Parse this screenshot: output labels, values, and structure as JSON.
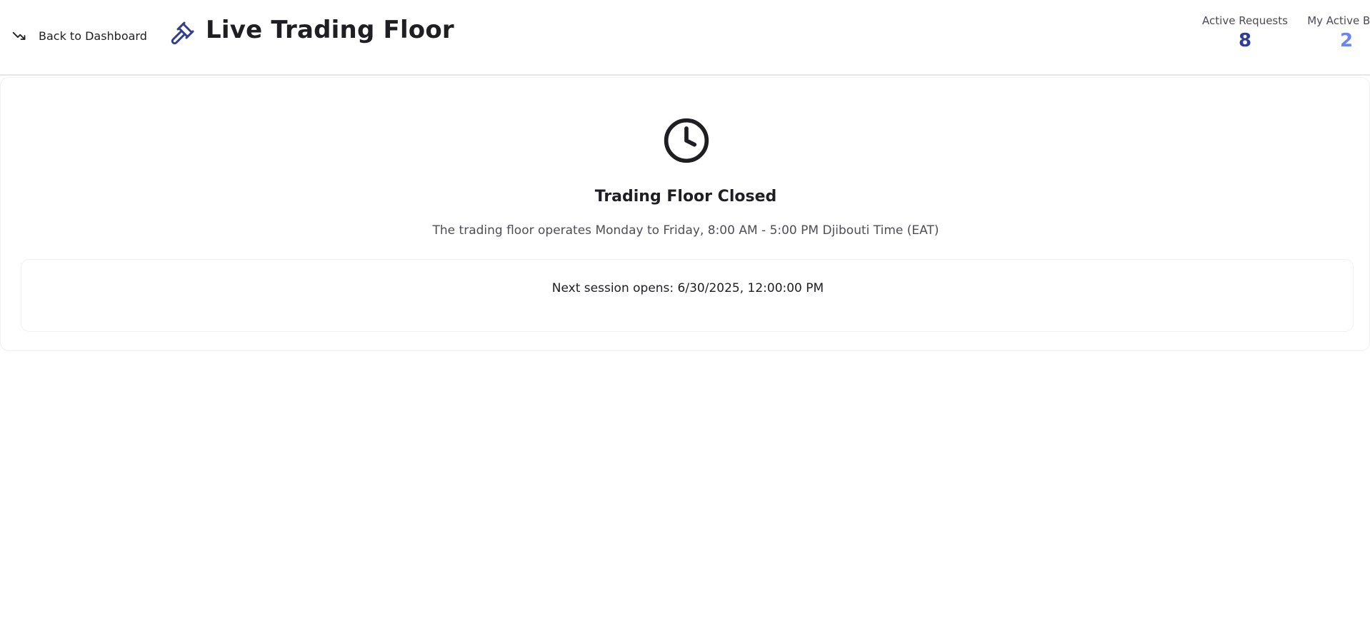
{
  "header": {
    "back_label": "Back to Dashboard",
    "back_icon": "trending-down-icon",
    "title": "Live Trading Floor",
    "title_icon": "gavel-icon",
    "stats": {
      "active_requests_label": "Active Requests",
      "active_requests_value": "8",
      "my_active_bids_label": "My Active Bids",
      "my_active_bids_value": "2"
    }
  },
  "status": {
    "icon": "clock-icon",
    "title": "Trading Floor Closed",
    "description": "The trading floor operates Monday to Friday, 8:00 AM - 5:00 PM Djibouti Time (EAT)",
    "next_session": "Next session opens: 6/30/2025, 12:00:00 PM"
  },
  "colors": {
    "primary_dark_blue": "#2f3c99",
    "accent_light_blue": "#6b85f0",
    "text_dark": "#1f1f23",
    "text_muted": "#4e4e58",
    "border": "#e6e6e9"
  }
}
